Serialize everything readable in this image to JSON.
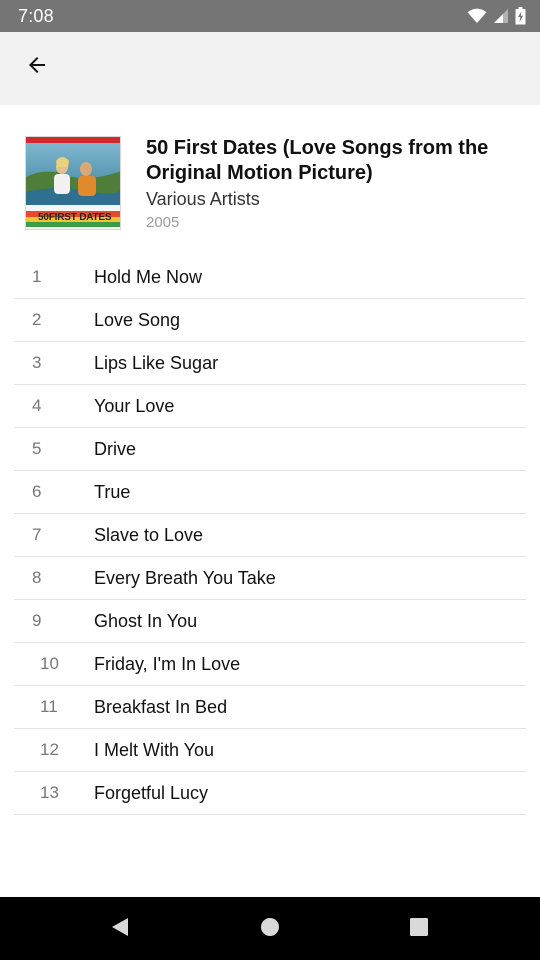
{
  "status_bar": {
    "time": "7:08",
    "icons": [
      "wifi-icon",
      "cell-signal-icon",
      "battery-icon"
    ]
  },
  "toolbar": {
    "back_icon": "back-arrow-icon"
  },
  "album": {
    "title": "50 First Dates (Love Songs from the Original Motion Picture)",
    "artist": "Various Artists",
    "year": "2005",
    "cover_text": "50FIRST DATES"
  },
  "tracks": [
    {
      "number": "1",
      "title": "Hold Me Now"
    },
    {
      "number": "2",
      "title": "Love Song"
    },
    {
      "number": "3",
      "title": "Lips Like Sugar"
    },
    {
      "number": "4",
      "title": "Your Love"
    },
    {
      "number": "5",
      "title": "Drive"
    },
    {
      "number": "6",
      "title": "True"
    },
    {
      "number": "7",
      "title": "Slave to Love"
    },
    {
      "number": "8",
      "title": "Every Breath You Take"
    },
    {
      "number": "9",
      "title": "Ghost In You"
    },
    {
      "number": "10",
      "title": "Friday, I'm In Love"
    },
    {
      "number": "11",
      "title": "Breakfast In Bed"
    },
    {
      "number": "12",
      "title": "I Melt With You"
    },
    {
      "number": "13",
      "title": "Forgetful Lucy"
    }
  ],
  "nav": {
    "icons": [
      "back-triangle-icon",
      "home-circle-icon",
      "recents-square-icon"
    ]
  },
  "colors": {
    "status_bar": "#757575",
    "app_bar": "#f2f2f2",
    "nav_bar": "#000000",
    "divider": "#e3e3e3"
  }
}
